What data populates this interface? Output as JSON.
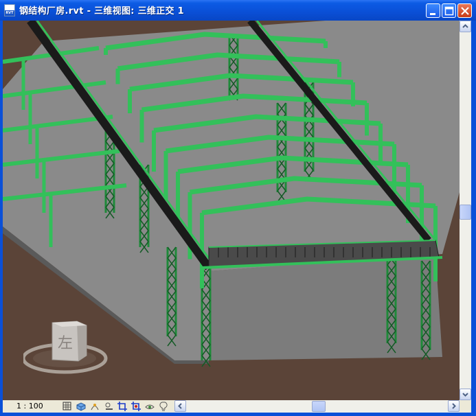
{
  "window": {
    "title": "钢结构厂房.rvt - 三维视图: 三维正交 1",
    "icon": "revit-file-icon",
    "icon_label": "RVT"
  },
  "titlebar_buttons": [
    "minimize-icon",
    "maximize-icon",
    "close-icon"
  ],
  "viewcube": {
    "face_label": "左"
  },
  "colors": {
    "viewport_background": "#5b4438",
    "steel_green": "#33c05a",
    "floor_gray": "#8a8a8a"
  },
  "statusbar": {
    "scale": "1 : 100",
    "tools": [
      "detail-level-icon",
      "visual-style-icon",
      "sun-path-icon",
      "shadows-icon",
      "crop-view-icon",
      "show-crop-icon",
      "temporary-hide-icon",
      "reveal-hidden-icon"
    ]
  }
}
